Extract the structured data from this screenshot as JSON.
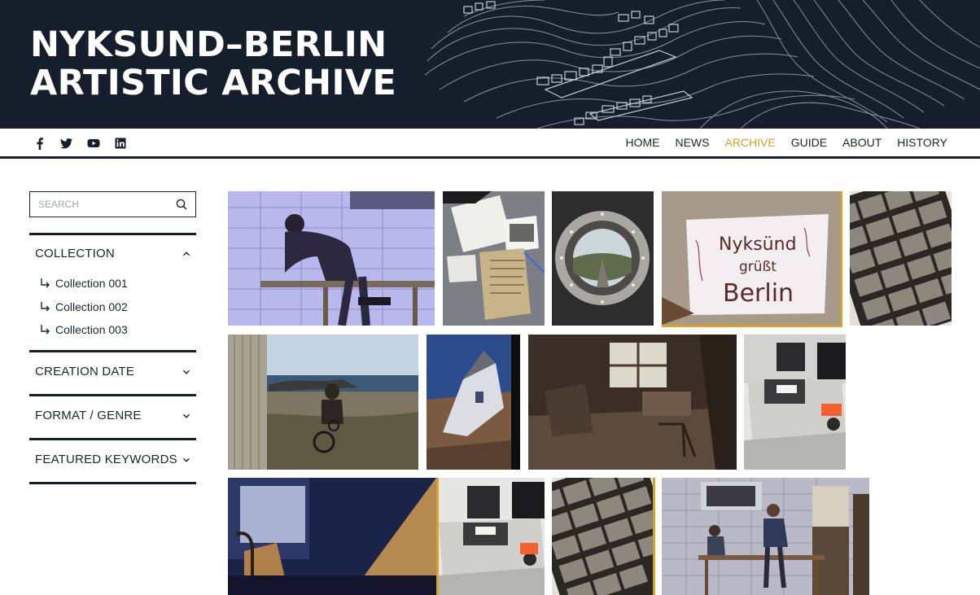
{
  "header": {
    "title_line1": "NYKSUND–BERLIN",
    "title_line2": "ARTISTIC ARCHIVE"
  },
  "social": [
    "facebook-icon",
    "twitter-icon",
    "youtube-icon",
    "linkedin-icon"
  ],
  "nav": {
    "items": [
      {
        "label": "HOME"
      },
      {
        "label": "NEWS"
      },
      {
        "label": "ARCHIVE",
        "active": true
      },
      {
        "label": "GUIDE"
      },
      {
        "label": "ABOUT"
      },
      {
        "label": "HISTORY"
      }
    ],
    "active_color": "#d6a22a"
  },
  "search": {
    "placeholder": "SEARCH"
  },
  "facets": [
    {
      "title": "COLLECTION",
      "expanded": true,
      "items": [
        "Collection 001",
        "Collection 002",
        "Collection 003"
      ]
    },
    {
      "title": "CREATION DATE",
      "expanded": false
    },
    {
      "title": "FORMAT / GENRE",
      "expanded": false
    },
    {
      "title": "FEATURED KEYWORDS",
      "expanded": false
    }
  ],
  "gallery": {
    "photo_text": {
      "banner_line1": "Nyksünd",
      "banner_line2": "grüßt",
      "banner_line3": "Berlin"
    }
  },
  "colors": {
    "header_bg": "#151e2b",
    "accent": "#d6a22a",
    "text": "#1a2330"
  }
}
